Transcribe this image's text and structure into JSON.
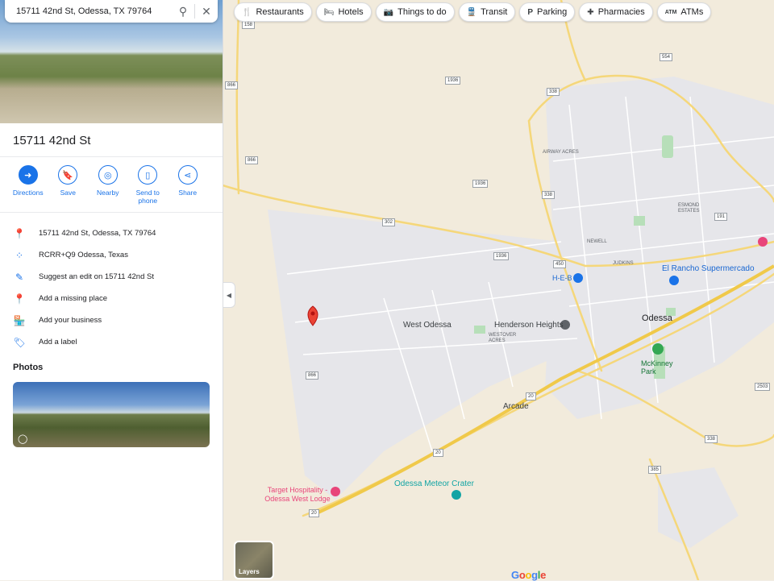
{
  "search": {
    "value": "15711 42nd St, Odessa, TX 79764"
  },
  "chips": [
    {
      "icon": "restaurant-icon",
      "glyph": "🍴",
      "label": "Restaurants"
    },
    {
      "icon": "hotel-icon",
      "glyph": "🛏",
      "label": "Hotels"
    },
    {
      "icon": "camera-icon",
      "glyph": "📷",
      "label": "Things to do"
    },
    {
      "icon": "transit-icon",
      "glyph": "🚆",
      "label": "Transit"
    },
    {
      "icon": "parking-icon",
      "glyph": "P",
      "label": "Parking"
    },
    {
      "icon": "pharmacy-icon",
      "glyph": "✚",
      "label": "Pharmacies"
    },
    {
      "icon": "atm-icon",
      "glyph": "ATM",
      "label": "ATMs"
    }
  ],
  "place": {
    "title": "15711 42nd St"
  },
  "actions": [
    {
      "label": "Directions",
      "icon": "directions-icon",
      "glyph": "➜"
    },
    {
      "label": "Save",
      "icon": "bookmark-icon",
      "glyph": "🔖"
    },
    {
      "label": "Nearby",
      "icon": "nearby-icon",
      "glyph": "◎"
    },
    {
      "label": "Send to phone",
      "icon": "send-to-phone-icon",
      "glyph": "▯"
    },
    {
      "label": "Share",
      "icon": "share-icon",
      "glyph": "⋖"
    }
  ],
  "info": [
    {
      "icon": "location-pin-icon",
      "glyph": "📍",
      "text": "15711 42nd St, Odessa, TX 79764"
    },
    {
      "icon": "plus-code-icon",
      "glyph": "⁘",
      "text": "RCRR+Q9 Odessa, Texas"
    },
    {
      "icon": "edit-icon",
      "glyph": "✎",
      "text": "Suggest an edit on 15711 42nd St"
    },
    {
      "icon": "add-place-icon",
      "glyph": "📍",
      "text": "Add a missing place"
    },
    {
      "icon": "add-business-icon",
      "glyph": "🏪",
      "text": "Add your business"
    },
    {
      "icon": "label-icon",
      "glyph": "🏷",
      "text": "Add a label"
    }
  ],
  "photos": {
    "heading": "Photos"
  },
  "layers": {
    "label": "Layers"
  },
  "map": {
    "places": [
      {
        "name": "West Odessa",
        "color": "#3c4043"
      },
      {
        "name": "Henderson Heights",
        "color": "#3c4043"
      },
      {
        "name": "WESTOVER ACRES",
        "color": "#5f6368"
      },
      {
        "name": "Odessa",
        "color": "#202124"
      },
      {
        "name": "Arcade",
        "color": "#3c4043"
      },
      {
        "name": "AIRWAY ACRES",
        "color": "#5f6368"
      },
      {
        "name": "ESMOND ESTATES",
        "color": "#5f6368"
      },
      {
        "name": "NEWELL",
        "color": "#5f6368"
      },
      {
        "name": "JUDKINS",
        "color": "#5f6368"
      },
      {
        "name": "McKinney Park",
        "color": "#137333"
      },
      {
        "name": "El Rancho Supermercado",
        "color": "#1967d2"
      },
      {
        "name": "H-E-B",
        "color": "#1967d2"
      },
      {
        "name": "Odessa Meteor Crater",
        "color": "#12a4a4"
      },
      {
        "name": "Target Hospitality - Odessa West Lodge",
        "color": "#e8457a"
      }
    ],
    "shields": [
      "158",
      "1936",
      "866",
      "554",
      "338",
      "1936",
      "866",
      "338",
      "302",
      "1936",
      "191",
      "450",
      "2503",
      "866",
      "20",
      "20",
      "338",
      "385",
      "20"
    ]
  },
  "google_logo": "Google"
}
